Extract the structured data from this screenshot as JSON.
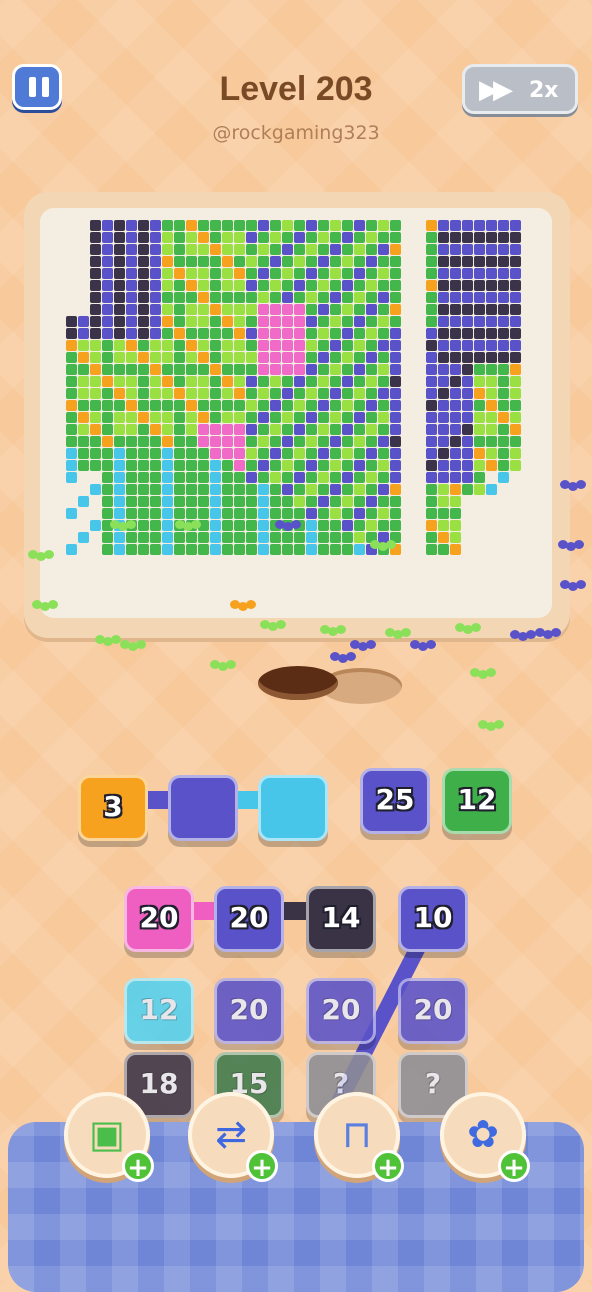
{
  "header": {
    "level_title": "Level 203",
    "username": "@rockgaming323",
    "speed_label": "2x",
    "speed_icon": "fast-forward-icon",
    "pause_icon": "pause-icon"
  },
  "colors": {
    "purple": "#5a52c9",
    "dark": "#3b3349",
    "green": "#43b74c",
    "lime": "#9be043",
    "pink": "#f06ac8",
    "cyan": "#47c6ea",
    "orange": "#f7a21f"
  },
  "queue": [
    {
      "color": "#f7a21f",
      "value": "3"
    },
    {
      "color": "#5a52c9",
      "value": ""
    },
    {
      "color": "#47c6ea",
      "value": ""
    },
    {
      "color": "#5a52c9",
      "value": "25"
    },
    {
      "color": "#3faf4a",
      "value": "12"
    }
  ],
  "grid": [
    [
      {
        "color": "#ef5fc1",
        "value": "20"
      },
      {
        "color": "#5a52c9",
        "value": "20"
      },
      {
        "color": "#3a3346",
        "value": "14"
      },
      {
        "color": "#5a52c9",
        "value": "10"
      }
    ],
    [
      {
        "color": "#52d1f0",
        "value": "12"
      },
      {
        "color": "#5a52c9",
        "value": "20"
      },
      {
        "color": "#5a52c9",
        "value": "20"
      },
      {
        "color": "#5a52c9",
        "value": "20"
      }
    ],
    [
      {
        "color": "#3a3346",
        "value": "18"
      },
      {
        "color": "#3e7a4c",
        "value": "15"
      },
      {
        "color": "#8d8d95",
        "value": "?"
      },
      {
        "color": "#8d8d95",
        "value": "?"
      }
    ]
  ],
  "tools": [
    {
      "icon": "add-box-icon",
      "name": "add-slot"
    },
    {
      "icon": "swap-arrows-icon",
      "name": "swap"
    },
    {
      "icon": "magnet-claw-icon",
      "name": "pick"
    },
    {
      "icon": "fan-icon",
      "name": "shuffle"
    }
  ]
}
